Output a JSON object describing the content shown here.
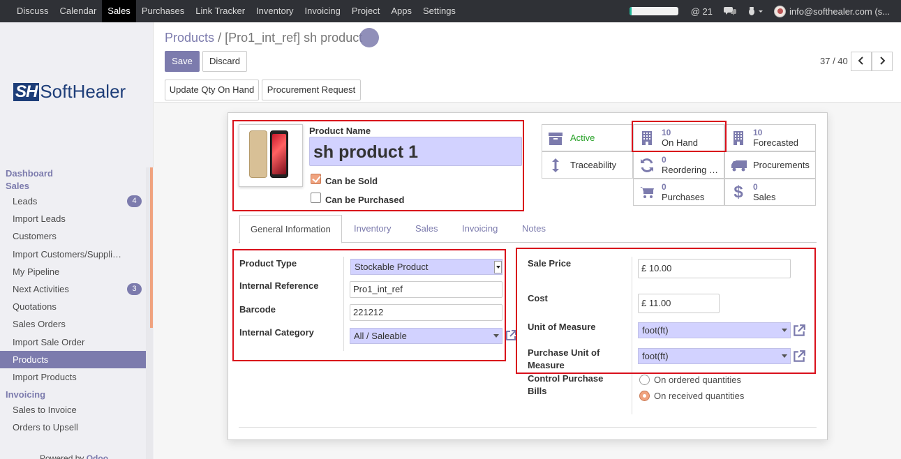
{
  "topbar": {
    "menu": [
      "Discuss",
      "Calendar",
      "Sales",
      "Purchases",
      "Link Tracker",
      "Inventory",
      "Invoicing",
      "Project",
      "Apps",
      "Settings"
    ],
    "active_menu": "Sales",
    "mentions_count": "@ 21",
    "user": "info@softhealer.com (s...",
    "progress_fraction": 0.04
  },
  "sidebar": {
    "logo_mark": "SH",
    "logo_word": "SoftHealer",
    "sections": [
      {
        "title": "Dashboard"
      },
      {
        "title": "Sales",
        "items": [
          {
            "label": "Leads",
            "badge": "4"
          },
          {
            "label": "Import Leads"
          },
          {
            "label": "Customers"
          },
          {
            "label": "Import Customers/Suppli…"
          },
          {
            "label": "My Pipeline"
          },
          {
            "label": "Next Activities",
            "badge": "3"
          },
          {
            "label": "Quotations"
          },
          {
            "label": "Sales Orders"
          },
          {
            "label": "Import Sale Order"
          },
          {
            "label": "Products",
            "active": true
          },
          {
            "label": "Import Products"
          }
        ]
      },
      {
        "title": "Invoicing",
        "items": [
          {
            "label": "Sales to Invoice"
          },
          {
            "label": "Orders to Upsell"
          }
        ]
      }
    ],
    "powered_by": "Powered by",
    "powered_brand": "Odoo"
  },
  "breadcrumb": {
    "parent": "Products",
    "separator": "/",
    "current": "[Pro1_int_ref] sh product"
  },
  "buttons": {
    "save": "Save",
    "discard": "Discard",
    "update_qty": "Update Qty On Hand",
    "procurement_request": "Procurement Request"
  },
  "pager": {
    "value": "37 / 40",
    "prev": "‹",
    "next": "›"
  },
  "product": {
    "name_label": "Product Name",
    "name": "sh product 1",
    "can_be_sold_label": "Can be Sold",
    "can_be_sold": true,
    "can_be_purchased_label": "Can be Purchased",
    "can_be_purchased": false
  },
  "smart_buttons": {
    "active": {
      "label": "Active"
    },
    "on_hand": {
      "value": "10",
      "label": "On Hand"
    },
    "forecasted": {
      "value": "10",
      "label": "Forecasted"
    },
    "traceability": {
      "label": "Traceability"
    },
    "reordering": {
      "value": "0",
      "label": "Reordering R..."
    },
    "procurements": {
      "label": "Procurements"
    },
    "purchases": {
      "value": "0",
      "label": "Purchases"
    },
    "sales": {
      "value": "0",
      "label": "Sales"
    }
  },
  "tabs": [
    "General Information",
    "Inventory",
    "Sales",
    "Invoicing",
    "Notes"
  ],
  "active_tab": "General Information",
  "general": {
    "product_type_label": "Product Type",
    "product_type": "Stockable Product",
    "internal_ref_label": "Internal Reference",
    "internal_ref": "Pro1_int_ref",
    "barcode_label": "Barcode",
    "barcode": "221212",
    "internal_category_label": "Internal Category",
    "internal_category": "All / Saleable",
    "sale_price_label": "Sale Price",
    "sale_price": "£ 10.00",
    "cost_label": "Cost",
    "cost": "£ 11.00",
    "uom_label": "Unit of Measure",
    "uom": "foot(ft)",
    "purchase_uom_label": "Purchase Unit of Measure",
    "purchase_uom": "foot(ft)",
    "control_bills_label": "Control Purchase Bills",
    "control_options": [
      "On ordered quantities",
      "On received quantities"
    ],
    "control_selected": "On received quantities"
  },
  "colors": {
    "accent": "#7c7bad",
    "navbar": "#2f3136",
    "highlight_box": "#d9101b",
    "required_field": "#d2d2ff"
  }
}
